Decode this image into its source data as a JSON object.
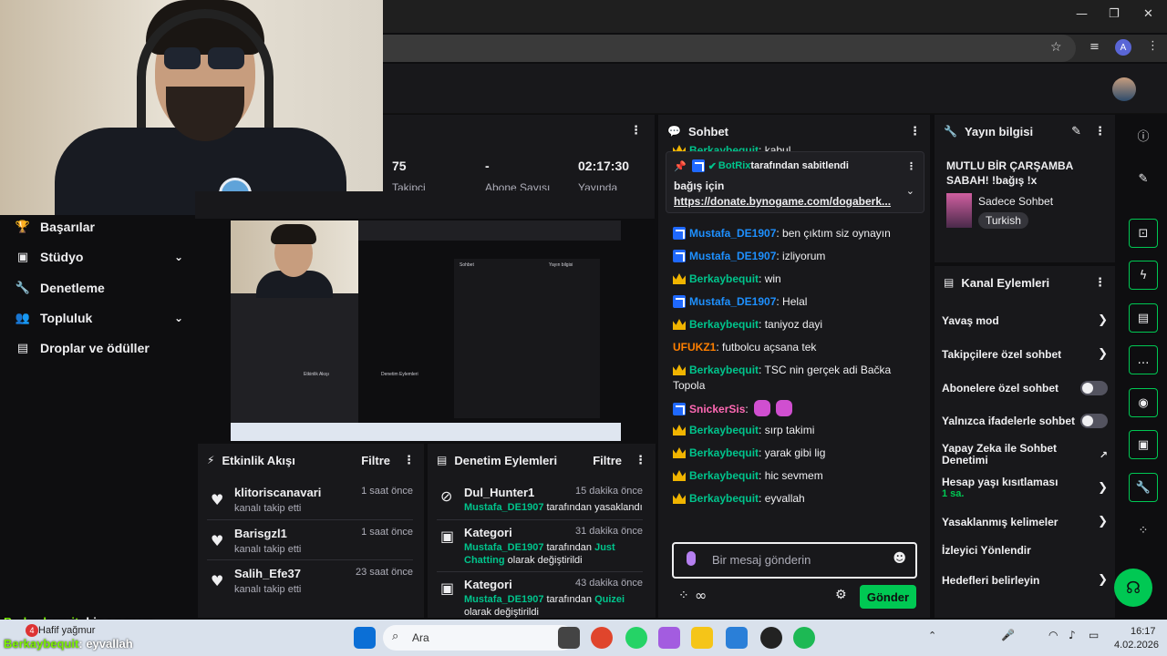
{
  "window": {
    "minimize": "—",
    "maximize": "❐",
    "close": "✕",
    "profile_letter": "A"
  },
  "nav": {
    "items": [
      {
        "label": "Başarılar",
        "icon": "trophy-icon",
        "glyph": "🏆",
        "chev": ""
      },
      {
        "label": "Stüdyo",
        "icon": "studio-icon",
        "glyph": "▣",
        "chev": "⌄"
      },
      {
        "label": "Denetleme",
        "icon": "wrench-icon",
        "glyph": "🔧",
        "chev": ""
      },
      {
        "label": "Topluluk",
        "icon": "community-icon",
        "glyph": "👥",
        "chev": "⌄"
      },
      {
        "label": "Droplar ve ödüller",
        "icon": "drops-icon",
        "glyph": "▤",
        "chev": ""
      }
    ]
  },
  "stats": {
    "viewers": "75",
    "followers": "-",
    "time": "02:17:30",
    "lbl1": "Takipçi",
    "lbl2": "Abone Sayısı",
    "lbl3": "Yayında"
  },
  "preview_mini": {
    "title": "Sohbet",
    "info": "Yayın bilgisi",
    "events": "Etkinlik Akışı",
    "mod": "Denetim Eylemleri"
  },
  "events": {
    "title": "Etkinlik Akışı",
    "filter": "Filtre",
    "more": "⋮",
    "rows": [
      {
        "name": "klitoriscanavari",
        "sub": "kanalı takip etti",
        "time": "1 saat önce"
      },
      {
        "name": "Barisgzl1",
        "sub": "kanalı takip etti",
        "time": "1 saat önce"
      },
      {
        "name": "Salih_Efe37",
        "sub": "kanalı takip etti",
        "time": "23 saat önce"
      }
    ]
  },
  "mod": {
    "title": "Denetim Eylemleri",
    "filter": "Filtre",
    "more": "⋮",
    "rows": [
      {
        "name": "Dul_Hunter1",
        "time": "15 dakika önce",
        "actor": "Mustafa_DE1907",
        "text": " tarafından yasaklandı",
        "extra": "",
        "tail": ""
      },
      {
        "name": "Kategori",
        "time": "31 dakika önce",
        "actor": "Mustafa_DE1907",
        "text": " tarafından ",
        "extra": "Just Chatting",
        "tail": " olarak değiştirildi"
      },
      {
        "name": "Kategori",
        "time": "43 dakika önce",
        "actor": "Mustafa_DE1907",
        "text": " tarafından ",
        "extra": "Quizei",
        "tail": " olarak değiştirildi"
      }
    ]
  },
  "chat": {
    "title": "Sohbet",
    "more": "⋮",
    "top_partial": {
      "user": "Berkaybequit",
      "text": ": kabul"
    },
    "pinned": {
      "by": "BotRix",
      "by_text": " tarafından sabitlendi",
      "line1": "bağış için",
      "link": "https://donate.bynogame.com/dogaberk..."
    },
    "messages": [
      {
        "user": "Mustafa_DE1907",
        "text": ": ben çıktım siz oynayın",
        "badge": "partner",
        "color": "blue"
      },
      {
        "user": "Mustafa_DE1907",
        "text": ": izliyorum",
        "badge": "partner",
        "color": "blue"
      },
      {
        "user": "Berkaybequit",
        "text": ": win",
        "badge": "crown",
        "color": "gold"
      },
      {
        "user": "Mustafa_DE1907",
        "text": ": Helal",
        "badge": "partner",
        "color": "blue"
      },
      {
        "user": "Berkaybequit",
        "text": ": taniyoz dayi",
        "badge": "crown",
        "color": "gold"
      },
      {
        "user": "UFUKZ1",
        "text": ": futbolcu açsana tek",
        "badge": "",
        "color": "orange"
      },
      {
        "user": "Berkaybequit",
        "text": ": TSC nin gerçek adi Bačka Topola",
        "badge": "crown",
        "color": "gold"
      },
      {
        "user": "SnickerSis",
        "text": ":",
        "badge": "partner",
        "color": "pink"
      },
      {
        "user": "Berkaybequit",
        "text": ": sırp takimi",
        "badge": "crown",
        "color": "gold"
      },
      {
        "user": "Berkaybequit",
        "text": ": yarak gibi lig",
        "badge": "crown",
        "color": "gold"
      },
      {
        "user": "Berkaybequit",
        "text": ": hic sevmem",
        "badge": "crown",
        "color": "gold"
      },
      {
        "user": "Berkaybequit",
        "text": ": eyvallah",
        "badge": "crown",
        "color": "gold"
      }
    ],
    "placeholder": "Bir mesaj gönderin",
    "send": "Gönder"
  },
  "info": {
    "title": "Yayın bilgisi",
    "stream_title": "MUTLU BİR ÇARŞAMBA SABAH! !bağış !x",
    "category": "Sadece Sohbet",
    "tag": "Turkish",
    "edit": "✎",
    "more": "⋮"
  },
  "actions": {
    "title": "Kanal Eylemleri",
    "more": "⋮",
    "items": [
      {
        "label": "Yavaş mod",
        "kind": "chev",
        "sub": ""
      },
      {
        "label": "Takipçilere özel sohbet",
        "kind": "chev",
        "sub": ""
      },
      {
        "label": "Abonelere özel sohbet",
        "kind": "toggle",
        "sub": ""
      },
      {
        "label": "Yalnızca ifadelerle sohbet",
        "kind": "toggle",
        "sub": ""
      },
      {
        "label": "Yapay Zeka ile Sohbet Denetimi",
        "kind": "ext",
        "sub": ""
      },
      {
        "label": "Hesap yaşı kısıtlaması",
        "kind": "chev",
        "sub": "1 sa."
      },
      {
        "label": "Yasaklanmış kelimeler",
        "kind": "chev",
        "sub": ""
      },
      {
        "label": "İzleyici Yönlendir",
        "kind": "none",
        "sub": ""
      },
      {
        "label": "Hedefleri belirleyin",
        "kind": "chev",
        "sub": ""
      }
    ]
  },
  "overlay": {
    "user1": "Berkaybequit",
    "msg1": ": hic sevmem",
    "user2": "Berkaybequit",
    "msg2": ": eyvallah"
  },
  "taskbar": {
    "weather": "Hafif yağmur",
    "weather_badge": "4",
    "search": "Ara",
    "time": "16:17",
    "date": "4.02.2026"
  },
  "colors": {
    "accent": "#00c853",
    "gold": "#f0b400",
    "partner": "#1f69ff",
    "link": "#1e90ff"
  }
}
